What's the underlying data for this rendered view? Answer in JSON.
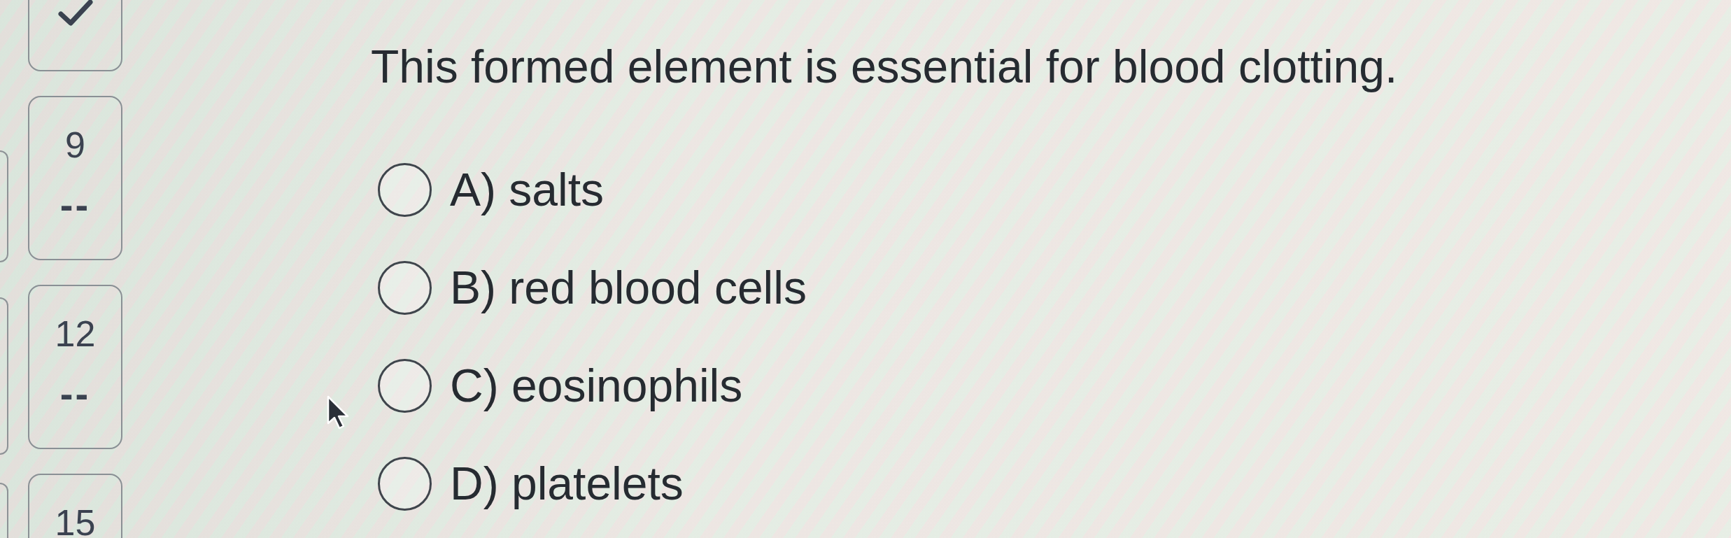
{
  "question_nav": [
    {
      "kind": "check"
    },
    {
      "kind": "number",
      "label": "9",
      "score": "--"
    },
    {
      "kind": "number",
      "label": "12",
      "score": "--"
    },
    {
      "kind": "number",
      "label": "15"
    }
  ],
  "question": {
    "text": "This formed element is essential for blood clotting.",
    "options": [
      {
        "label": "A) salts",
        "selected": false
      },
      {
        "label": "B) red blood cells",
        "selected": false
      },
      {
        "label": "C) eosinophils",
        "selected": false
      },
      {
        "label": "D) platelets",
        "selected": false
      }
    ]
  }
}
